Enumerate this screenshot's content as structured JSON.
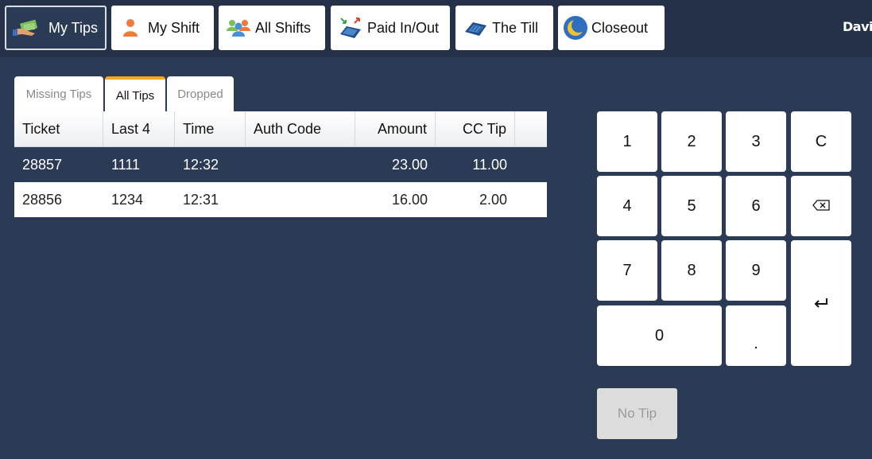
{
  "toolbar": {
    "buttons": [
      {
        "label": "My Tips",
        "icon": "money-hand-icon"
      },
      {
        "label": "My Shift",
        "icon": "person-icon"
      },
      {
        "label": "All Shifts",
        "icon": "group-icon"
      },
      {
        "label": "Paid In/Out",
        "icon": "register-arrows-icon"
      },
      {
        "label": "The Till",
        "icon": "till-drawer-icon"
      },
      {
        "label": "Closeout",
        "icon": "moon-icon"
      }
    ],
    "user": "David"
  },
  "tabs": [
    {
      "label": "Missing Tips"
    },
    {
      "label": "All Tips"
    },
    {
      "label": "Dropped"
    }
  ],
  "table": {
    "headers": [
      "Ticket",
      "Last 4",
      "Time",
      "Auth Code",
      "Amount",
      "CC Tip"
    ],
    "rows": [
      [
        "28857",
        "1111",
        "12:32",
        "",
        "23.00",
        "11.00"
      ],
      [
        "28856",
        "1234",
        "12:31",
        "",
        "16.00",
        "2.00"
      ]
    ]
  },
  "keypad": {
    "k1": "1",
    "k2": "2",
    "k3": "3",
    "clear": "C",
    "k4": "4",
    "k5": "5",
    "k6": "6",
    "backspace_icon": "backspace-icon",
    "k7": "7",
    "k8": "8",
    "k9": "9",
    "enter_icon": "enter-icon",
    "k0": "0",
    "dot": "."
  },
  "no_tip_label": "No Tip",
  "colors": {
    "background": "#2b3a55",
    "toolbar": "#253149",
    "active_tab_accent": "#f5a623",
    "selected_row": "#2b3a55"
  }
}
